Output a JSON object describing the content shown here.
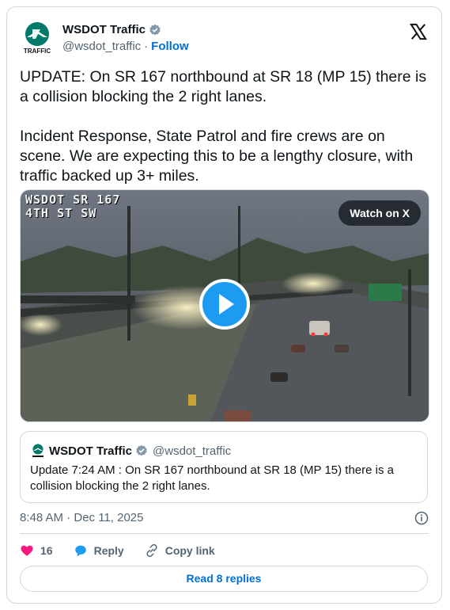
{
  "author": {
    "name": "WSDOT Traffic",
    "handle": "@wsdot_traffic",
    "separator": "·",
    "follow_label": "Follow",
    "avatar_text": "TRAFFIC"
  },
  "tweet": {
    "text": "UPDATE: On SR 167 northbound at SR 18 (MP 15) there is\na collision blocking the 2 right lanes.\n\nIncident Response, State Patrol and fire crews are on\nscene. We are expecting this to be a lengthy closure, with\ntraffic backed up 3+ miles."
  },
  "media": {
    "camera_label": "WSDOT SR 167\n4TH ST SW",
    "watch_label": "Watch on X",
    "play_icon": "play-icon"
  },
  "quote": {
    "name": "WSDOT Traffic",
    "handle": "@wsdot_traffic",
    "text": "Update 7:24 AM : On SR 167 northbound at SR 18 (MP 15) there is a\ncollision blocking the 2 right lanes."
  },
  "meta": {
    "timestamp": "8:48 AM · Dec 11, 2025"
  },
  "actions": {
    "like_count": "16",
    "reply_label": "Reply",
    "copy_label": "Copy link"
  },
  "read_replies_label": "Read 8 replies",
  "colors": {
    "brand_green": "#00796b",
    "link_blue": "#006fd6",
    "play_blue": "#1d9bf0",
    "heart_red": "#f91880"
  }
}
